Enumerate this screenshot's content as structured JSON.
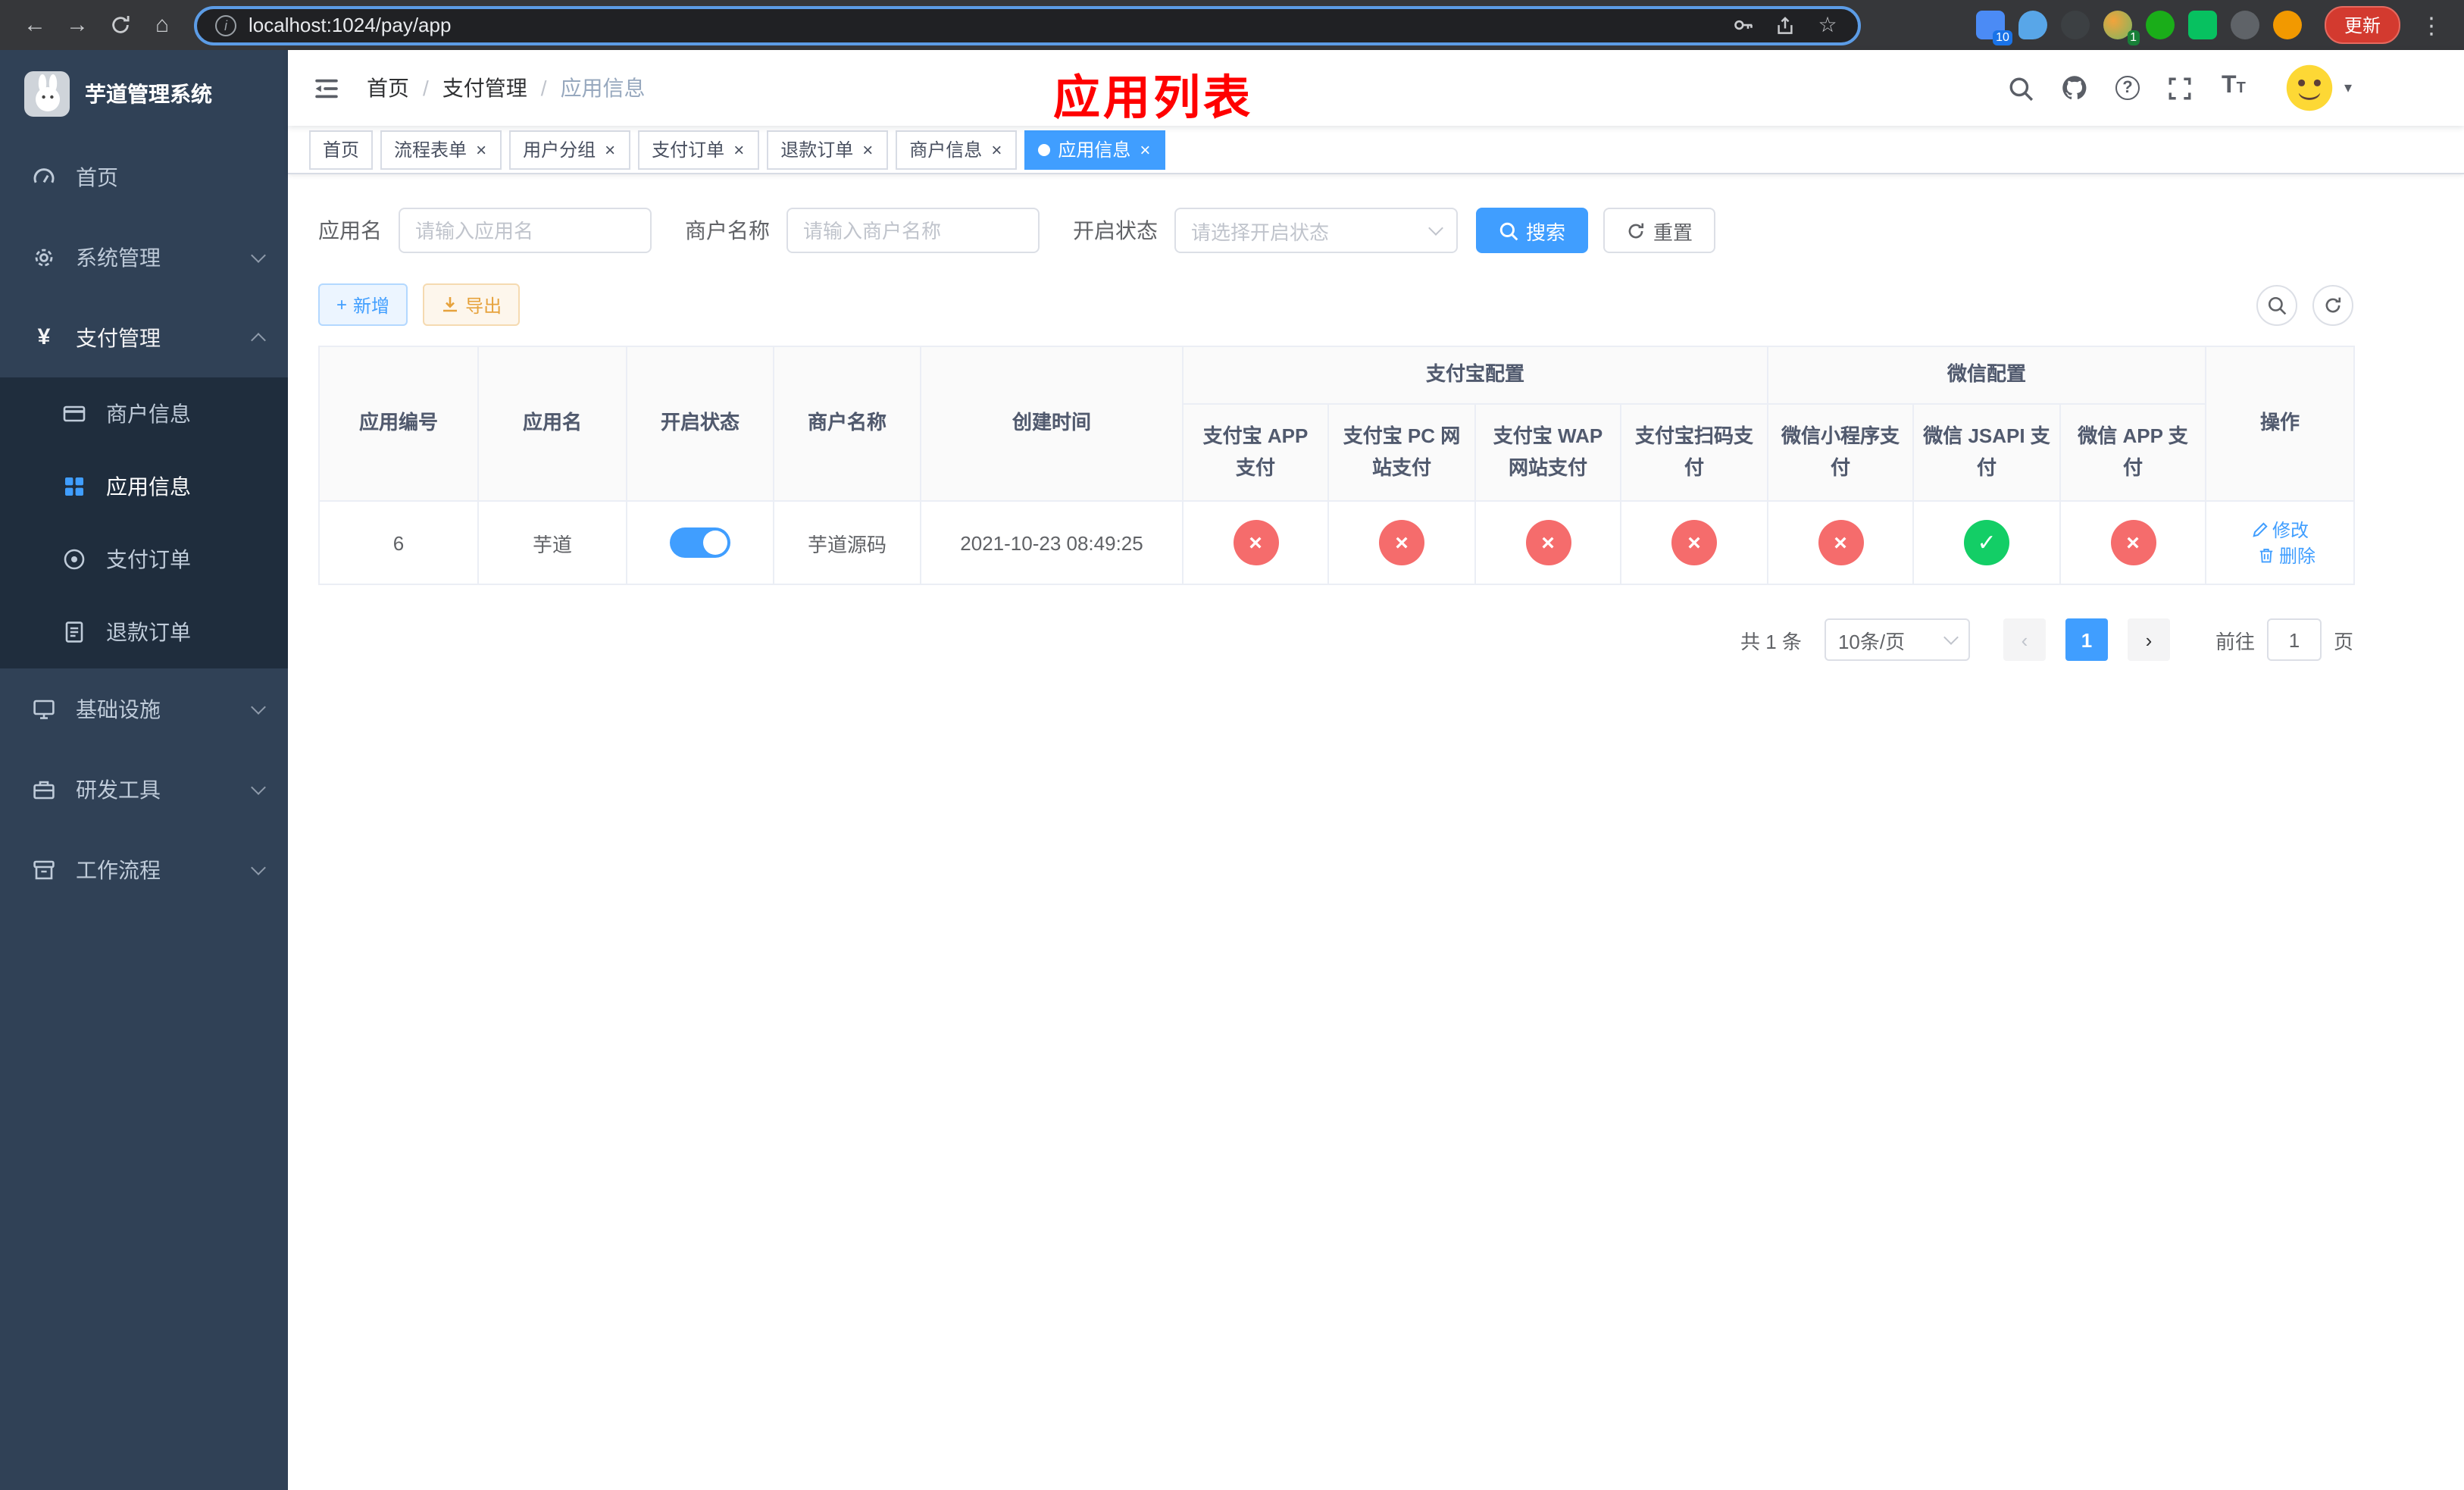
{
  "colors": {
    "accent": "#409eff",
    "danger": "#f56c6c",
    "success": "#13ce66",
    "annotation_red": "#ff0000",
    "sidebar_bg": "#304156",
    "sidebar_submenu_bg": "#1f2d3d",
    "update_button_bg": "#d33a2f"
  },
  "icons": {
    "ok": "✓",
    "fail": "×",
    "close": "×",
    "back": "←",
    "forward": "→",
    "home": "⌂",
    "menu_dots": "⋮",
    "info": "i",
    "question": "?",
    "star": "☆",
    "yen": "¥",
    "caret": "▾",
    "plus": "+",
    "prev": "‹",
    "next": "›",
    "font": "T"
  },
  "browser": {
    "url": "localhost:1024/pay/app",
    "update_button": "更新",
    "extension_badge_1": "10",
    "extension_badge_2": "1"
  },
  "sidebar": {
    "title": "芋道管理系统",
    "home": "首页",
    "system": "系统管理",
    "payment": "支付管理",
    "merchant_info": "商户信息",
    "app_info": "应用信息",
    "pay_order": "支付订单",
    "refund_order": "退款订单",
    "infra": "基础设施",
    "dev_tools": "研发工具",
    "workflow": "工作流程"
  },
  "header": {
    "breadcrumb": [
      "首页",
      "支付管理",
      "应用信息"
    ],
    "separator": "/",
    "annotation": "应用列表"
  },
  "tabs": [
    {
      "label": "首页"
    },
    {
      "label": "流程表单"
    },
    {
      "label": "用户分组"
    },
    {
      "label": "支付订单"
    },
    {
      "label": "退款订单"
    },
    {
      "label": "商户信息"
    },
    {
      "label": "应用信息"
    }
  ],
  "filters": {
    "app_name_label": "应用名",
    "app_name_placeholder": "请输入应用名",
    "merchant_label": "商户名称",
    "merchant_placeholder": "请输入商户名称",
    "status_label": "开启状态",
    "status_placeholder": "请选择开启状态",
    "search": "搜索",
    "reset": "重置"
  },
  "toolbar": {
    "add": "新增",
    "export": "导出"
  },
  "table": {
    "col_app_id": "应用编号",
    "col_app_name": "应用名",
    "col_status": "开启状态",
    "col_merchant": "商户名称",
    "col_created": "创建时间",
    "group_alipay": "支付宝配置",
    "group_wechat": "微信配置",
    "col_alipay_app": "支付宝 APP 支付",
    "col_alipay_pc": "支付宝 PC 网站支付",
    "col_alipay_wap": "支付宝 WAP 网站支付",
    "col_alipay_qr": "支付宝扫码支付",
    "col_wx_mini": "微信小程序支付",
    "col_wx_jsapi": "微信 JSAPI 支付",
    "col_wx_app": "微信 APP 支付",
    "col_ops": "操作",
    "row": {
      "id": "6",
      "name": "芋道",
      "status_on": true,
      "merchant": "芋道源码",
      "created": "2021-10-23 08:49:25",
      "alipay_app": false,
      "alipay_pc": false,
      "alipay_wap": false,
      "alipay_qr": false,
      "wx_mini": false,
      "wx_jsapi": true,
      "wx_app": false,
      "edit": "修改",
      "delete": "删除"
    }
  },
  "pagination": {
    "total": "共 1 条",
    "page_size": "10条/页",
    "page": "1",
    "goto_label": "前往",
    "goto_value": "1",
    "page_unit": "页"
  }
}
